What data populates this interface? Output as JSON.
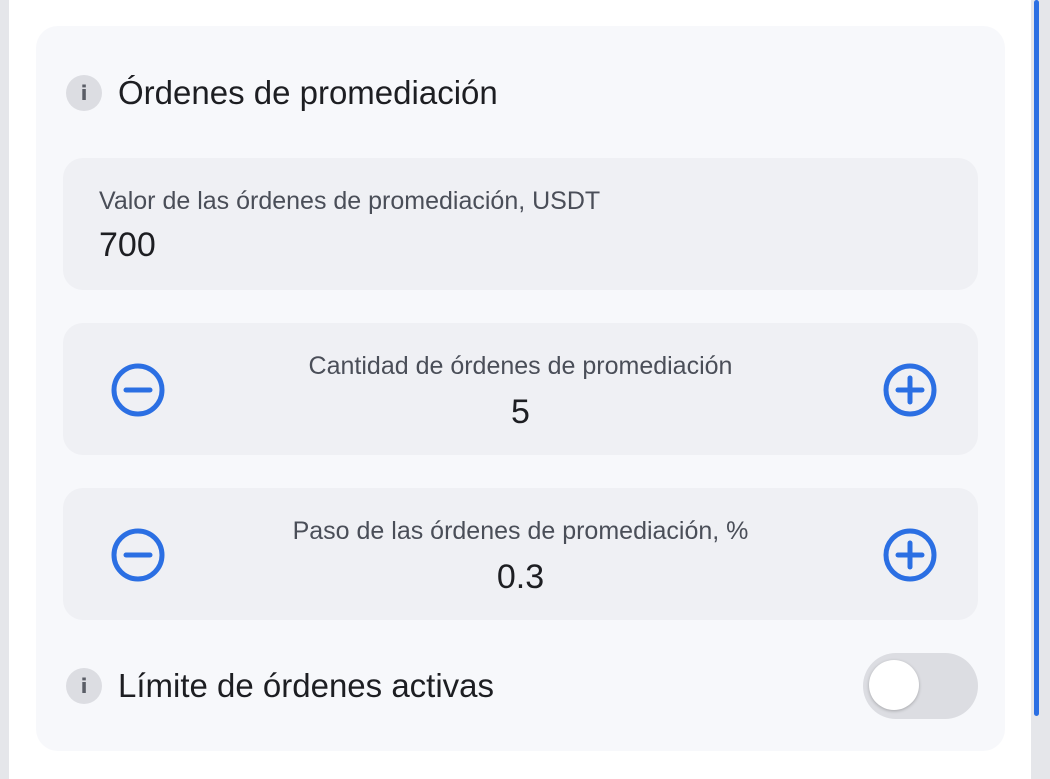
{
  "section_averaging": {
    "info_icon": "info-icon",
    "title": "Órdenes de promediación"
  },
  "averaging_value": {
    "label": "Valor de las órdenes de promediación, USDT",
    "value": "700"
  },
  "averaging_count": {
    "label": "Cantidad de órdenes de promediación",
    "value": "5",
    "decrement_icon": "minus-circle-icon",
    "increment_icon": "plus-circle-icon"
  },
  "averaging_step": {
    "label": "Paso de las órdenes de promediación, %",
    "value": "0.3",
    "decrement_icon": "minus-circle-icon",
    "increment_icon": "plus-circle-icon"
  },
  "active_orders_limit": {
    "info_icon": "info-icon",
    "label": "Límite de órdenes activas",
    "enabled": false
  },
  "colors": {
    "accent": "#2b6fe3",
    "panel_bg": "#f7f8fb",
    "card_bg": "#eff0f4",
    "toggle_off": "#dcdde2"
  }
}
